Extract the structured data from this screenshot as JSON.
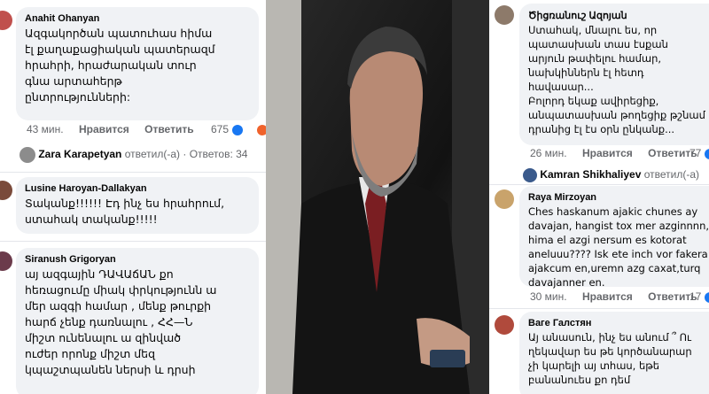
{
  "left": {
    "c1": {
      "author": "Anahit Ohanyan",
      "text": "Ազգակործան պատուհաս հիմա\nէլ քաղաքացիական պատերազմ\nհրահրի, հրաժարական տուր\nգնա արտահերթ\nընտրությունների:",
      "time": "43 мин.",
      "like": "Нравится",
      "reply": "Ответить",
      "count": "675"
    },
    "reply1": {
      "name": "Zara Karapetyan",
      "action": "ответил(-а)",
      "count": "· Ответов: 34"
    },
    "c2": {
      "author": "Lusine Haroyan-Dallakyan",
      "text": "Տականք!!!!!! Էդ ինչ ես հրահրում,\nստահակ տականք!!!!!"
    },
    "c3": {
      "author": "Siranush Grigoryan",
      "text": "այ ազգային ԴԱՎԱճԱՆ  քո\nհեռացումը միակ փրկությունն ա\nմեր ազգի համար , մենք թուրքի\nհարճ չենք դառնալու , ՀՀ—Ն\nմիշտ ունենալու ա զինված\nուժեր որոնք միշտ մեզ\nկպաշտպանեն ներսի և դրսի"
    }
  },
  "right": {
    "c1": {
      "author": "Ծիցռանուշ Ազոյան",
      "text": "Ստահակ, մնալու ես, որ\nպատասխան տաս էսքան\nարյուն թափելու համար,\nնախկիններն էլ հետդ\nհավասար...\nԲոլորդ եկաք ավիրեցիք,\nանպատասխան թողեցիք թշնամ\nդրանից էլ էս օրն ընկանք...",
      "time": "26 мин.",
      "like": "Нравится",
      "reply": "Ответить",
      "count": "77"
    },
    "reply1": {
      "name": "Kamran Shikhaliyev",
      "action": "ответил(-а)"
    },
    "c2": {
      "author": "Raya Mirzoyan",
      "text": "Ches haskanum ajakic chunes ay\ndavajan, hangist tox mer azginnnn,\nhima el azgi nersum es kotorat\naneluuu???? Isk ete inch vor fakera\najakcum en,uremn azg caxat,turq\ndavajanner en.",
      "time": "30 мин.",
      "like": "Нравится",
      "reply": "Ответить",
      "count": "17"
    },
    "c3": {
      "author": "Ваге Галстян",
      "text": "Այ անասուն, ինչ ես անում ՞ Ու\nղեկավար ես թե կործանարար\nչի կարելի այ տհաս, եթե\nբանանուես քո դեմ"
    }
  }
}
